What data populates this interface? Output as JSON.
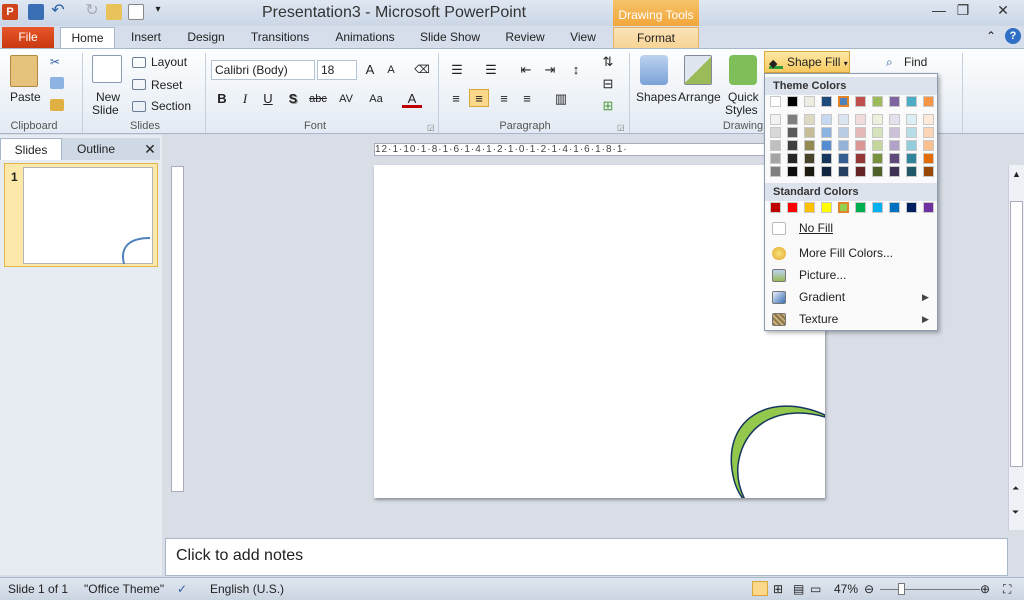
{
  "window": {
    "title": "Presentation3 - Microsoft PowerPoint",
    "context_tab": "Drawing Tools"
  },
  "tabs": {
    "file": "File",
    "home": "Home",
    "insert": "Insert",
    "design": "Design",
    "transitions": "Transitions",
    "animations": "Animations",
    "slideshow": "Slide Show",
    "review": "Review",
    "view": "View",
    "format": "Format"
  },
  "ribbon": {
    "clipboard": {
      "paste": "Paste",
      "label": "Clipboard"
    },
    "slides": {
      "new_slide_1": "New",
      "new_slide_2": "Slide",
      "layout": "Layout",
      "reset": "Reset",
      "section": "Section",
      "label": "Slides"
    },
    "font": {
      "name": "Calibri (Body)",
      "size": "18",
      "label": "Font",
      "bold": "B",
      "italic": "I",
      "underline": "U",
      "shadow": "S",
      "strike": "abc",
      "spacing": "AV",
      "case": "Aa",
      "color": "A"
    },
    "paragraph": {
      "label": "Paragraph"
    },
    "drawing": {
      "shapes": "Shapes",
      "arrange": "Arrange",
      "quick_styles_1": "Quick",
      "quick_styles_2": "Styles",
      "shape_fill": "Shape Fill",
      "label": "Drawing"
    },
    "editing": {
      "find": "Find"
    }
  },
  "fill_menu": {
    "theme_header": "Theme Colors",
    "standard_header": "Standard Colors",
    "theme_row": [
      "#ffffff",
      "#000000",
      "#eeece1",
      "#1f497d",
      "#4f81bd",
      "#c0504d",
      "#9bbb59",
      "#8064a2",
      "#4bacc6",
      "#f79646"
    ],
    "theme_shades": [
      [
        "#f2f2f2",
        "#7f7f7f",
        "#ddd9c3",
        "#c6d9f0",
        "#dbe5f1",
        "#f2dcdb",
        "#ebf1dd",
        "#e5e0ec",
        "#dbeef3",
        "#fdeada"
      ],
      [
        "#d8d8d8",
        "#595959",
        "#c4bd97",
        "#8db3e2",
        "#b8cce4",
        "#e5b9b7",
        "#d7e3bc",
        "#ccc1d9",
        "#b7dde8",
        "#fbd5b5"
      ],
      [
        "#bfbfbf",
        "#3f3f3f",
        "#938953",
        "#548dd4",
        "#95b3d7",
        "#d99694",
        "#c3d69b",
        "#b2a2c7",
        "#92cddc",
        "#fac08f"
      ],
      [
        "#a5a5a5",
        "#262626",
        "#494429",
        "#17365d",
        "#366092",
        "#953734",
        "#76923c",
        "#5f497a",
        "#31859b",
        "#e36c09"
      ],
      [
        "#7f7f7f",
        "#0c0c0c",
        "#1d1b10",
        "#0f243e",
        "#244061",
        "#632423",
        "#4f6128",
        "#3f3151",
        "#205867",
        "#974806"
      ]
    ],
    "standard_row": [
      "#c00000",
      "#ff0000",
      "#ffc000",
      "#ffff00",
      "#92d050",
      "#00b050",
      "#00b0f0",
      "#0070c0",
      "#002060",
      "#7030a0"
    ],
    "no_fill": "No Fill",
    "more_colors": "More Fill Colors...",
    "picture": "Picture...",
    "gradient": "Gradient",
    "texture": "Texture"
  },
  "pane": {
    "slides_tab": "Slides",
    "outline_tab": "Outline",
    "slide_number": "1"
  },
  "ruler": {
    "h": "12·1·10·1·8·1·6·1·4·1·2·1·0·1·2·1·4·1·6·1·8·1·"
  },
  "notes": {
    "placeholder": "Click to add notes"
  },
  "status": {
    "slide": "Slide 1 of 1",
    "theme": "\"Office Theme\"",
    "language": "English (U.S.)",
    "zoom": "47%"
  },
  "colors": {
    "accent_green": "#92c94c",
    "accent_blue": "#17365d"
  }
}
